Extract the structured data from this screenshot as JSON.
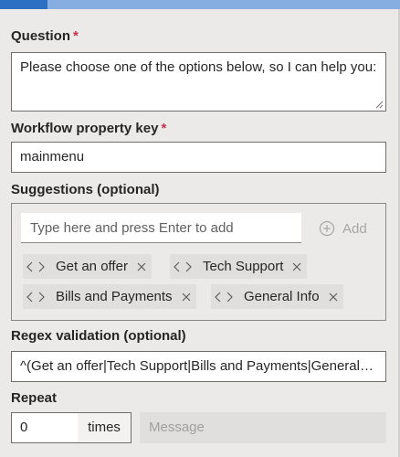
{
  "question": {
    "label": "Question",
    "required_mark": "*",
    "value": "Please choose one of the options below, so I can help you:"
  },
  "property_key": {
    "label": "Workflow property key",
    "required_mark": "*",
    "value": "mainmenu"
  },
  "suggestions": {
    "label": "Suggestions (optional)",
    "input_placeholder": "Type here and press Enter to add",
    "add_label": "Add",
    "items": [
      "Get an offer",
      "Tech Support",
      "Bills and Payments",
      "General Info"
    ]
  },
  "regex": {
    "label": "Regex validation (optional)",
    "value": "^(Get an offer|Tech Support|Bills and Payments|General Info)$"
  },
  "repeat": {
    "label": "Repeat",
    "value": "0",
    "suffix": "times",
    "message_placeholder": "Message"
  },
  "colors": {
    "accent": "#2d6fc2",
    "required": "#c4314b",
    "chip_bg": "#e1dfdd"
  }
}
